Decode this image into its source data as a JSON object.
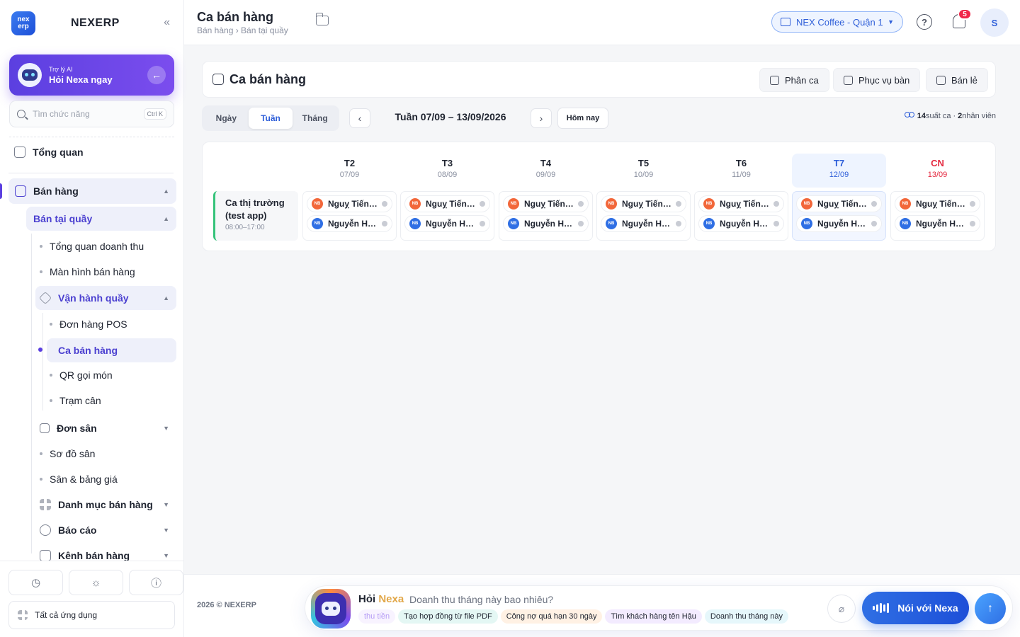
{
  "app": {
    "name": "NEXERP",
    "logo_text": "nex erp"
  },
  "ai_card": {
    "subtitle": "Trợ lý AI",
    "title": "Hỏi Nexa ngay"
  },
  "search": {
    "placeholder": "Tìm chức năng",
    "shortcut": "Ctrl K"
  },
  "nav": {
    "overview": "Tổng quan",
    "sales": "Bán hàng",
    "counter_sales": "Bán tại quầy",
    "revenue_overview": "Tổng quan doanh thu",
    "sales_screen": "Màn hình bán hàng",
    "counter_ops": "Vận hành quầy",
    "pos_orders": "Đơn hàng POS",
    "shifts": "Ca bán hàng",
    "qr_order": "QR gọi món",
    "scale_station": "Trạm cân",
    "court_orders": "Đơn sân",
    "court_map": "Sơ đồ sân",
    "courts_pricing": "Sân & bảng giá",
    "sales_catalog": "Danh mục bán hàng",
    "reports": "Báo cáo",
    "sales_channels": "Kênh bán hàng"
  },
  "sidebar_bottom": {
    "all_apps": "Tất cả ứng dụng"
  },
  "header": {
    "title": "Ca bán hàng",
    "breadcrumb": "Bán hàng › Bán tại quầy",
    "store": "NEX Coffee - Quận 1",
    "notification_count": "5",
    "avatar_initial": "S"
  },
  "card": {
    "title": "Ca bán hàng",
    "actions": [
      "Phân ca",
      "Phục vụ bàn",
      "Bán lẻ"
    ]
  },
  "view_tabs": {
    "day": "Ngày",
    "week": "Tuần",
    "month": "Tháng",
    "selected": "Tuần"
  },
  "week": {
    "range": "Tuần 07/09 – 13/09/2026",
    "today": "Hôm nay"
  },
  "stats": {
    "shifts": "14",
    "shifts_label": "suất ca ·",
    "staff": "2",
    "staff_label": "nhân viên"
  },
  "days": [
    {
      "name": "T2",
      "date": "07/09"
    },
    {
      "name": "T3",
      "date": "08/09"
    },
    {
      "name": "T4",
      "date": "09/09"
    },
    {
      "name": "T5",
      "date": "10/09"
    },
    {
      "name": "T6",
      "date": "11/09"
    },
    {
      "name": "T7",
      "date": "12/09"
    },
    {
      "name": "CN",
      "date": "13/09"
    }
  ],
  "today_index": 5,
  "shift": {
    "name": "Ca thị trường (test app)",
    "time": "08:00–17:00"
  },
  "staff_initials": "NB",
  "assignments": [
    [
      "Nguỵ Tiến…",
      "Nguyễn H…"
    ],
    [
      "Nguỵ Tiến…",
      "Nguyễn H…"
    ],
    [
      "Nguỵ Tiến…",
      "Nguyễn H…"
    ],
    [
      "Nguỵ Tiến…",
      "Nguyễn H…"
    ],
    [
      "Nguỵ Tiến…",
      "Nguyễn H…"
    ],
    [
      "Nguỵ Tiến…",
      "Nguyễn H…"
    ],
    [
      "Nguỵ Tiến Bảo",
      "Nguyễn Hoài…"
    ]
  ],
  "footer": {
    "copyright": "2026 © NEXERP",
    "ask_label": "Hỏi",
    "ask_brand": "Nexa",
    "prompt": "Doanh thu tháng này bao nhiêu?",
    "suggestions": [
      "thu tiền",
      "Tạo hợp đồng từ file PDF",
      "Công nợ quá hạn 30 ngày",
      "Tìm khách hàng tên Hậu",
      "Doanh thu tháng này"
    ],
    "talk": "Nói với Nexa"
  }
}
